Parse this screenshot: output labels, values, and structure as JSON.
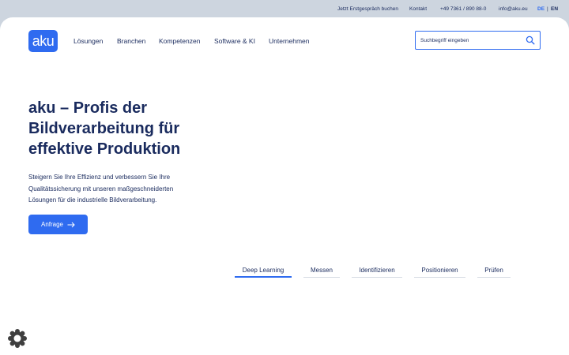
{
  "topbar": {
    "consult": "Jetzt Erstgespräch buchen",
    "contact": "Kontakt",
    "phone": "+49 7361 / 890 88-0",
    "email": "info@aku.eu",
    "lang_de": "DE",
    "lang_sep": "|",
    "lang_en": "EN"
  },
  "logo": {
    "text": "aku"
  },
  "nav": {
    "items": [
      {
        "label": "Lösungen"
      },
      {
        "label": "Branchen"
      },
      {
        "label": "Kompetenzen"
      },
      {
        "label": "Software & KI"
      },
      {
        "label": "Unternehmen"
      }
    ]
  },
  "search": {
    "placeholder": "Suchbegriff eingeben",
    "icon": "search-icon"
  },
  "hero": {
    "title_lines": [
      "aku – Profis der",
      "Bildverarbeitung für",
      "effektive Produktion"
    ],
    "text_lines": [
      "Steigern Sie Ihre Effizienz und verbessern Sie Ihre",
      "Qualitätssicherung mit unseren maßgeschneiderten",
      "Lösungen für die industrielle Bildverarbeitung."
    ],
    "cta_label": "Anfrage",
    "cta_icon": "arrow-right-icon"
  },
  "tabs": [
    {
      "label": "Deep Learning",
      "active": true
    },
    {
      "label": "Messen",
      "active": false
    },
    {
      "label": "Identifizieren",
      "active": false
    },
    {
      "label": "Positionieren",
      "active": false
    },
    {
      "label": "Prüfen",
      "active": false
    }
  ],
  "cookie": {
    "icon": "cookie-settings-icon"
  },
  "colors": {
    "accent": "#2f6bf0",
    "text": "#1a2b5e",
    "background": "#cdd5df"
  }
}
